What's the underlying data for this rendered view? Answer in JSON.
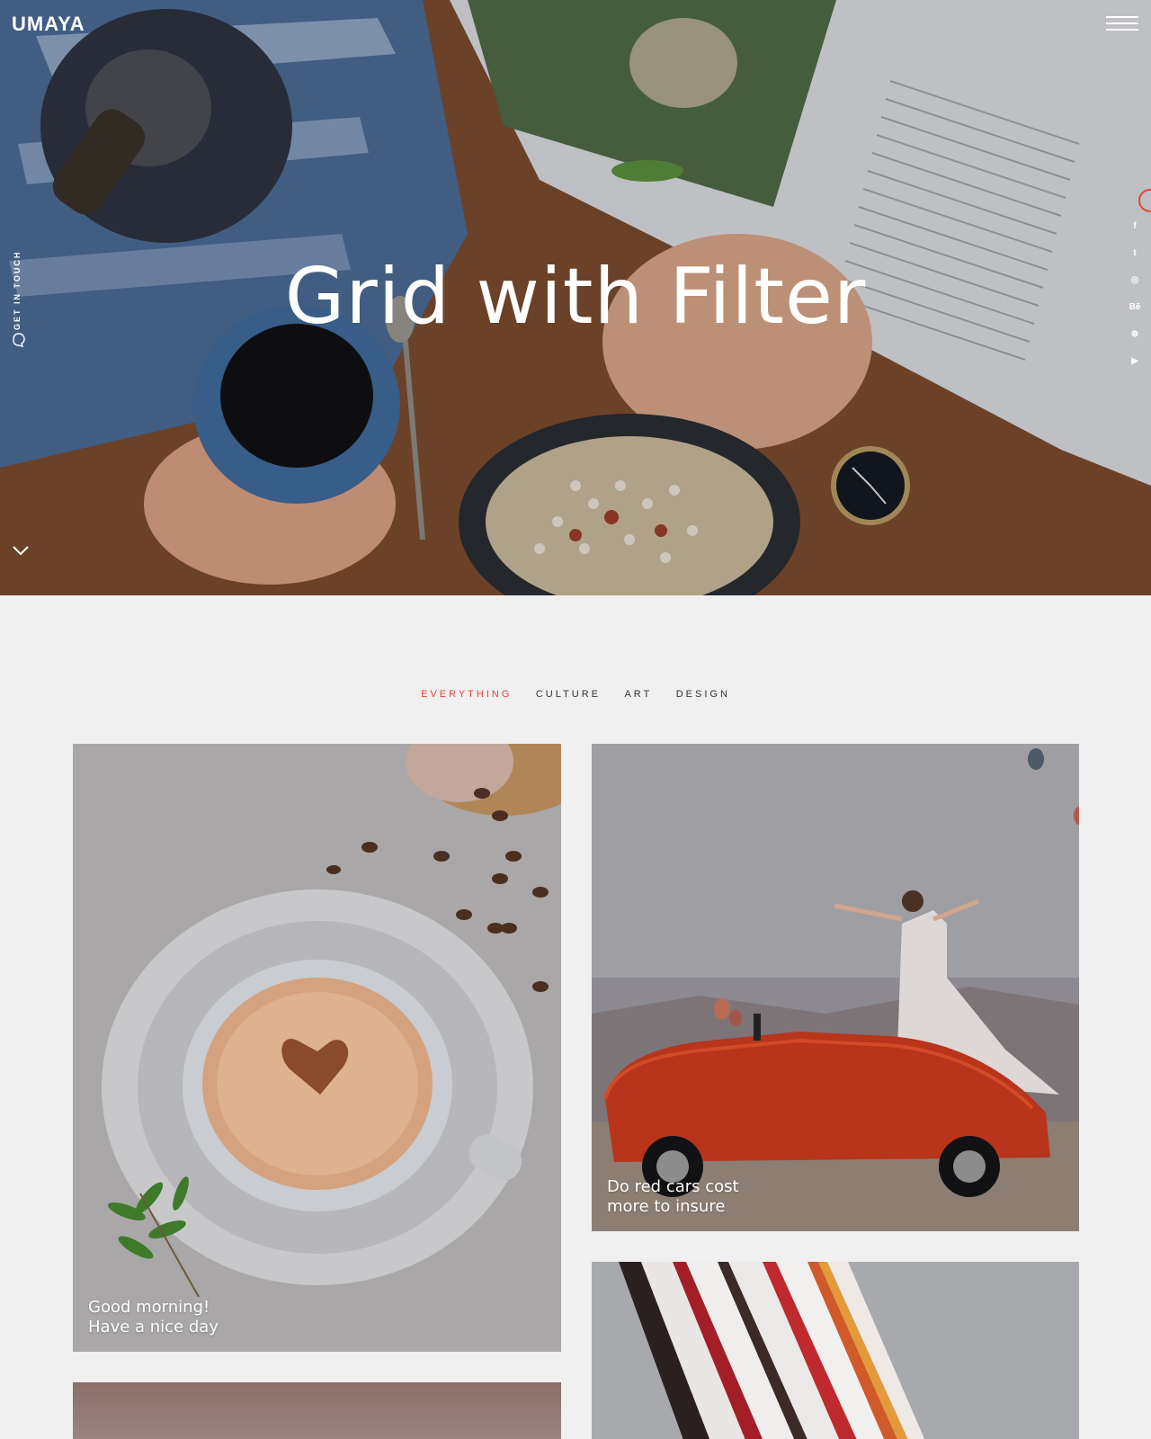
{
  "header": {
    "logo": "UMAYA",
    "menu_icon": "hamburger-icon"
  },
  "hero": {
    "title": "Grid with Filter",
    "side_label": "GET IN TOUCH",
    "scroll_icon": "chevron-down-icon"
  },
  "social": [
    {
      "name": "facebook-icon",
      "glyph": "f"
    },
    {
      "name": "twitter-icon",
      "glyph": "t"
    },
    {
      "name": "instagram-icon",
      "glyph": "◎"
    },
    {
      "name": "behance-icon",
      "glyph": "Bē"
    },
    {
      "name": "dribbble-icon",
      "glyph": "⊛"
    },
    {
      "name": "youtube-icon",
      "glyph": "▶"
    }
  ],
  "filters": {
    "everything": "EVERYTHING",
    "culture": "CULTURE",
    "art": "ART",
    "design": "DESIGN"
  },
  "cards": [
    {
      "line1": "Good morning!",
      "line2": "Have a nice day"
    },
    {
      "line1": "Do red cars cost",
      "line2": "more to insure"
    }
  ],
  "colors": {
    "accent": "#e5463b",
    "page_bg": "#f0f0f0",
    "text_dark": "#333333"
  }
}
